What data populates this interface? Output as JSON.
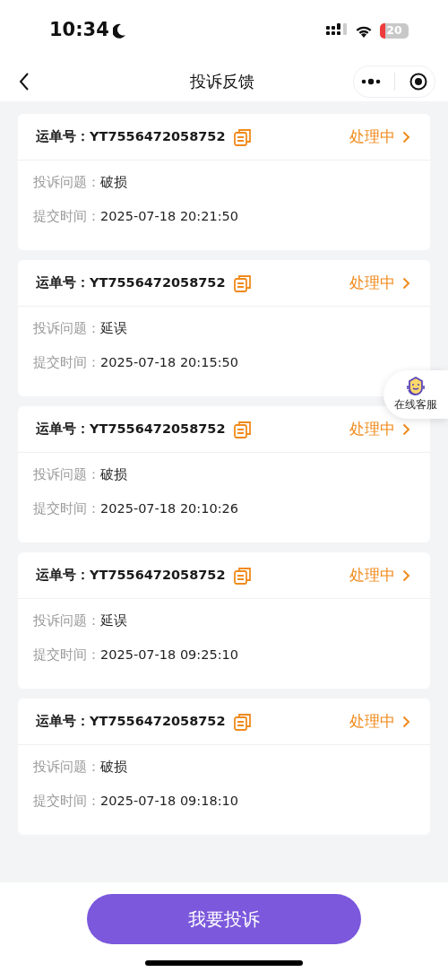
{
  "status_bar": {
    "time": "10:34",
    "battery": "20"
  },
  "nav": {
    "title": "投诉反馈"
  },
  "complaints": [
    {
      "waybill_label": "运单号：",
      "waybill": "YT7556472058752",
      "status": "处理中",
      "issue_label": "投诉问题：",
      "issue": "破损",
      "time_label": "提交时间：",
      "time": "2025-07-18 20:21:50"
    },
    {
      "waybill_label": "运单号：",
      "waybill": "YT7556472058752",
      "status": "处理中",
      "issue_label": "投诉问题：",
      "issue": "延误",
      "time_label": "提交时间：",
      "time": "2025-07-18 20:15:50"
    },
    {
      "waybill_label": "运单号：",
      "waybill": "YT7556472058752",
      "status": "处理中",
      "issue_label": "投诉问题：",
      "issue": "破损",
      "time_label": "提交时间：",
      "time": "2025-07-18 20:10:26"
    },
    {
      "waybill_label": "运单号：",
      "waybill": "YT7556472058752",
      "status": "处理中",
      "issue_label": "投诉问题：",
      "issue": "延误",
      "time_label": "提交时间：",
      "time": "2025-07-18 09:25:10"
    },
    {
      "waybill_label": "运单号：",
      "waybill": "YT7556472058752",
      "status": "处理中",
      "issue_label": "投诉问题：",
      "issue": "破损",
      "time_label": "提交时间：",
      "time": "2025-07-18 09:18:10"
    }
  ],
  "support": {
    "label": "在线客服"
  },
  "submit_button": "我要投诉"
}
